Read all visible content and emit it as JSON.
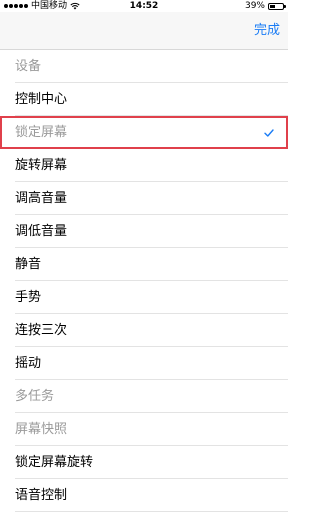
{
  "status": {
    "carrier": "中国移动",
    "time": "14:52",
    "battery": "39%",
    "battery_level": 0.39
  },
  "nav": {
    "done_label": "完成"
  },
  "list": {
    "items": [
      {
        "label": "设备",
        "enabled": false,
        "checked": false
      },
      {
        "label": "控制中心",
        "enabled": true,
        "checked": false
      },
      {
        "label": "锁定屏幕",
        "enabled": false,
        "checked": true
      },
      {
        "label": "旋转屏幕",
        "enabled": true,
        "checked": false
      },
      {
        "label": "调高音量",
        "enabled": true,
        "checked": false
      },
      {
        "label": "调低音量",
        "enabled": true,
        "checked": false
      },
      {
        "label": "静音",
        "enabled": true,
        "checked": false
      },
      {
        "label": "手势",
        "enabled": true,
        "checked": false
      },
      {
        "label": "连按三次",
        "enabled": true,
        "checked": false
      },
      {
        "label": "摇动",
        "enabled": true,
        "checked": false
      },
      {
        "label": "多任务",
        "enabled": false,
        "checked": false
      },
      {
        "label": "屏幕快照",
        "enabled": false,
        "checked": false
      },
      {
        "label": "锁定屏幕旋转",
        "enabled": true,
        "checked": false
      },
      {
        "label": "语音控制",
        "enabled": true,
        "checked": false
      }
    ]
  },
  "colors": {
    "accent": "#1a7cf5",
    "highlight_frame": "#e0404b",
    "disabled_text": "#9a9a9a"
  }
}
